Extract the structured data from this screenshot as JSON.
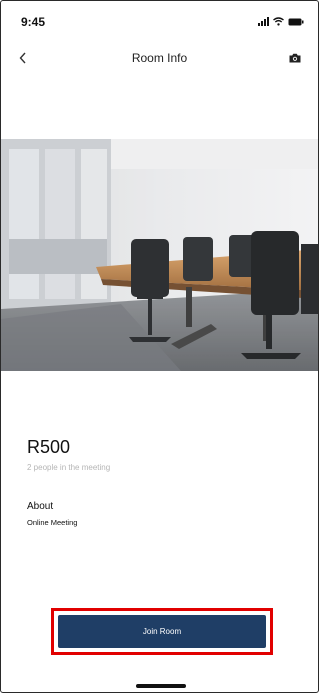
{
  "status_bar": {
    "time": "9:45"
  },
  "header": {
    "title": "Room Info"
  },
  "room": {
    "price": "R500",
    "people_count": "2 people in the meeting",
    "about_label": "About",
    "about_value": "Online Meeting"
  },
  "actions": {
    "join_label": "Join Room"
  },
  "icons": {
    "back": "chevron-left-icon",
    "camera": "camera-icon",
    "signal": "signal-icon",
    "wifi": "wifi-icon",
    "battery": "battery-icon"
  },
  "colors": {
    "primary_button": "#1f3e66",
    "highlight": "#e10000",
    "muted_text": "#b5b5b5"
  }
}
